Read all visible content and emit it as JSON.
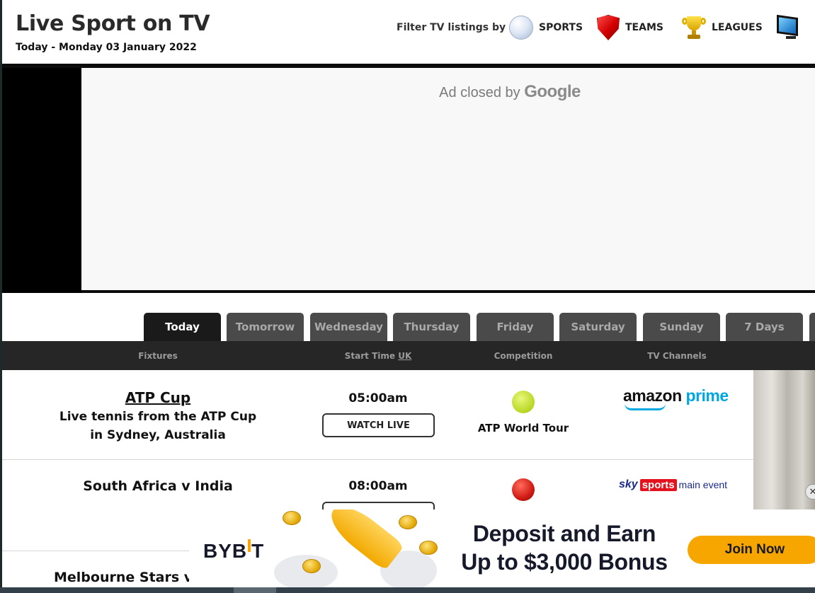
{
  "header": {
    "title": "Live Sport on TV",
    "date": "Today - Monday 03 January 2022",
    "filter_label": "Filter TV listings by",
    "filters": [
      {
        "label": "SPORTS",
        "icon": "volleyball-icon"
      },
      {
        "label": "TEAMS",
        "icon": "shield-icon"
      },
      {
        "label": "LEAGUES",
        "icon": "trophy-icon"
      },
      {
        "label": "",
        "icon": "tv-icon"
      }
    ]
  },
  "ad": {
    "closed_text": "Ad closed by",
    "brand": "Google"
  },
  "tabs": [
    "Today",
    "Tomorrow",
    "Wednesday",
    "Thursday",
    "Friday",
    "Saturday",
    "Sunday",
    "7 Days"
  ],
  "active_tab": "Today",
  "columns": {
    "fixtures": "Fixtures",
    "start_time": "Start Time",
    "start_time_zone": "UK",
    "competition": "Competition",
    "tv_channels": "TV Channels"
  },
  "rows": [
    {
      "fixture": "ATP Cup",
      "description": "Live tennis from the ATP Cup in Sydney, Australia",
      "time": "05:00am",
      "button": "WATCH LIVE",
      "competition": "ATP World Tour",
      "channel": {
        "part1": "amazon",
        "part2": "prime"
      }
    },
    {
      "fixture": "South Africa v India",
      "time": "08:00am",
      "competition": "",
      "channel": {
        "part1": "sky",
        "part2": "sports",
        "part3": "main event"
      }
    },
    {
      "fixture": "Melbourne Stars v M"
    }
  ],
  "banner": {
    "brand": "BYBIT",
    "headline_line1": "Deposit and Earn",
    "headline_line2": "Up to $3,000 Bonus",
    "cta": "Join Now",
    "accent_color": "#f7a600"
  },
  "side_ad": {
    "close_symbol": "✕"
  }
}
